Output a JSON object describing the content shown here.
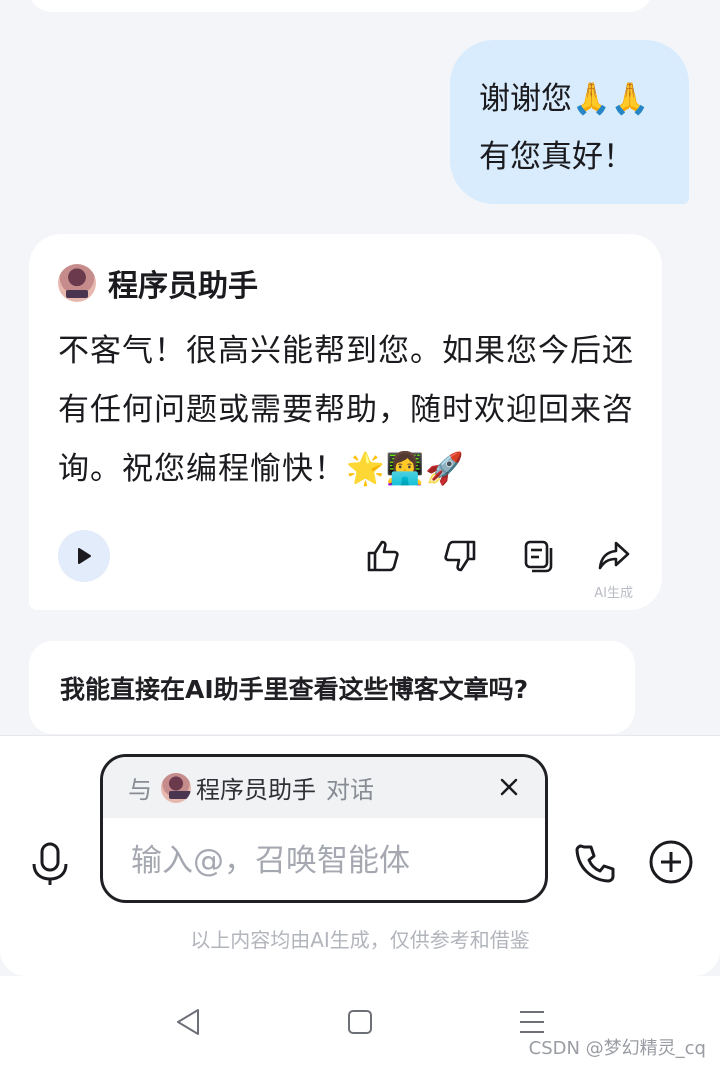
{
  "user_message": {
    "lines": [
      "谢谢您🙏🙏",
      "有您真好！"
    ]
  },
  "bot_message": {
    "name": "程序员助手",
    "text": "不客气！很高兴能帮到您。如果您今后还有任何问题或需要帮助，随时欢迎回来咨询。祝您编程愉快！🌟👩‍💻🚀",
    "ai_mark": "AI生成",
    "actions": [
      "play-icon",
      "thumbs-up-icon",
      "thumbs-down-icon",
      "copy-icon",
      "share-icon"
    ]
  },
  "suggestion": {
    "text": "我能直接在AI助手里查看这些博客文章吗?"
  },
  "input": {
    "chip_prefix": "与",
    "chip_name": "程序员助手",
    "chip_suffix": "对话",
    "placeholder": "输入@，召唤智能体",
    "disclaimer": "以上内容均由AI生成，仅供参考和借鉴"
  },
  "watermark": "CSDN @梦幻精灵_cq",
  "colors": {
    "user_bubble": "#d8ecfd",
    "play_button": "#e3ecfb",
    "background": "#f4f5f8"
  }
}
